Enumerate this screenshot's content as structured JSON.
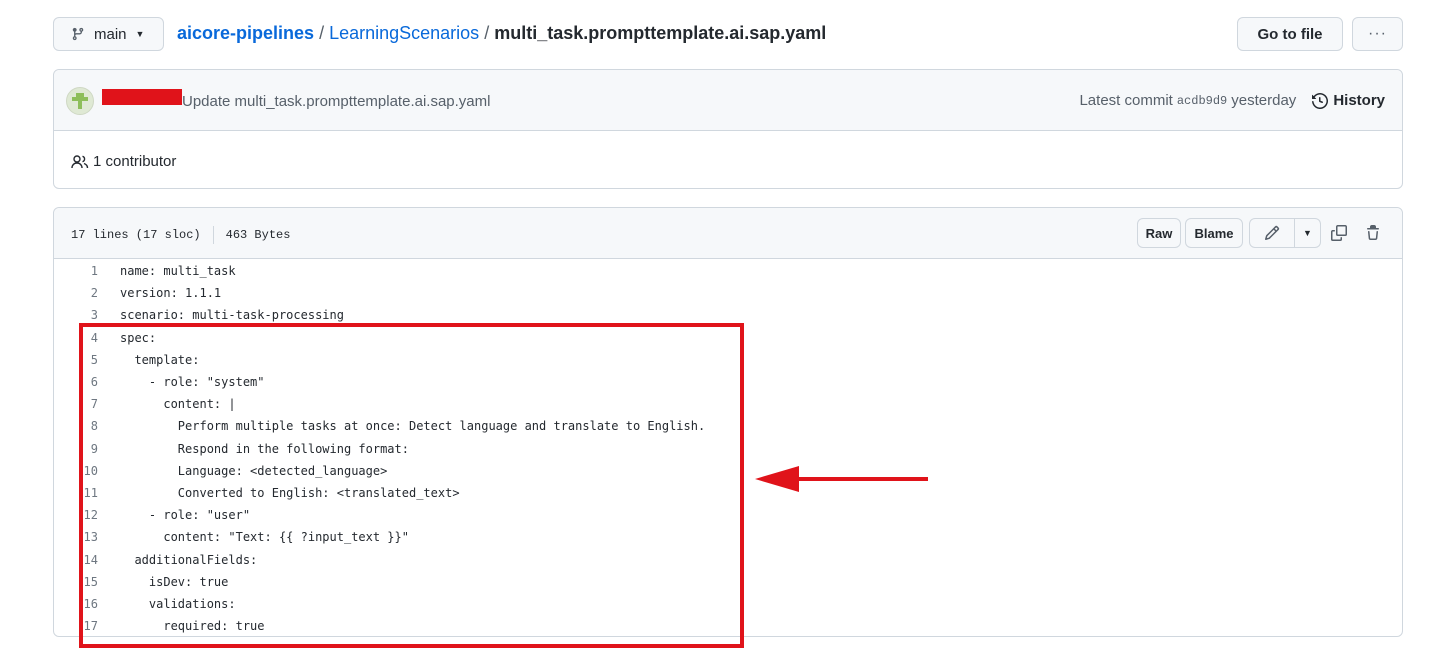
{
  "topbar": {
    "branch": "main",
    "breadcrumb": {
      "repo": "aicore-pipelines",
      "sep1": "/",
      "dir": "LearningScenarios",
      "sep2": "/",
      "file": "multi_task.prompttemplate.ai.sap.yaml"
    },
    "go_to_file": "Go to file",
    "more": "···"
  },
  "commit": {
    "message": "Update multi_task.prompttemplate.ai.sap.yaml",
    "latest_label": "Latest commit",
    "sha": "acdb9d9",
    "when": "yesterday",
    "history": "History",
    "contributors": "1 contributor"
  },
  "file": {
    "lines_info": "17 lines (17 sloc)",
    "size": "463 Bytes",
    "raw": "Raw",
    "blame": "Blame",
    "code": [
      {
        "n": "1",
        "text": "name: multi_task"
      },
      {
        "n": "2",
        "text": "version: 1.1.1"
      },
      {
        "n": "3",
        "text": "scenario: multi-task-processing"
      },
      {
        "n": "4",
        "text": "spec:"
      },
      {
        "n": "5",
        "text": "  template:"
      },
      {
        "n": "6",
        "text": "    - role: \"system\""
      },
      {
        "n": "7",
        "text": "      content: |"
      },
      {
        "n": "8",
        "text": "        Perform multiple tasks at once: Detect language and translate to English."
      },
      {
        "n": "9",
        "text": "        Respond in the following format:"
      },
      {
        "n": "10",
        "text": "        Language: <detected_language>"
      },
      {
        "n": "11",
        "text": "        Converted to English: <translated_text>"
      },
      {
        "n": "12",
        "text": "    - role: \"user\""
      },
      {
        "n": "13",
        "text": "      content: \"Text: {{ ?input_text }}\""
      },
      {
        "n": "14",
        "text": "  additionalFields:"
      },
      {
        "n": "15",
        "text": "    isDev: true"
      },
      {
        "n": "16",
        "text": "    validations:"
      },
      {
        "n": "17",
        "text": "      required: true"
      }
    ]
  },
  "colors": {
    "link": "#0969da",
    "annotation": "#e0131a",
    "border": "#d0d7de",
    "header_bg": "#f6f8fa"
  }
}
